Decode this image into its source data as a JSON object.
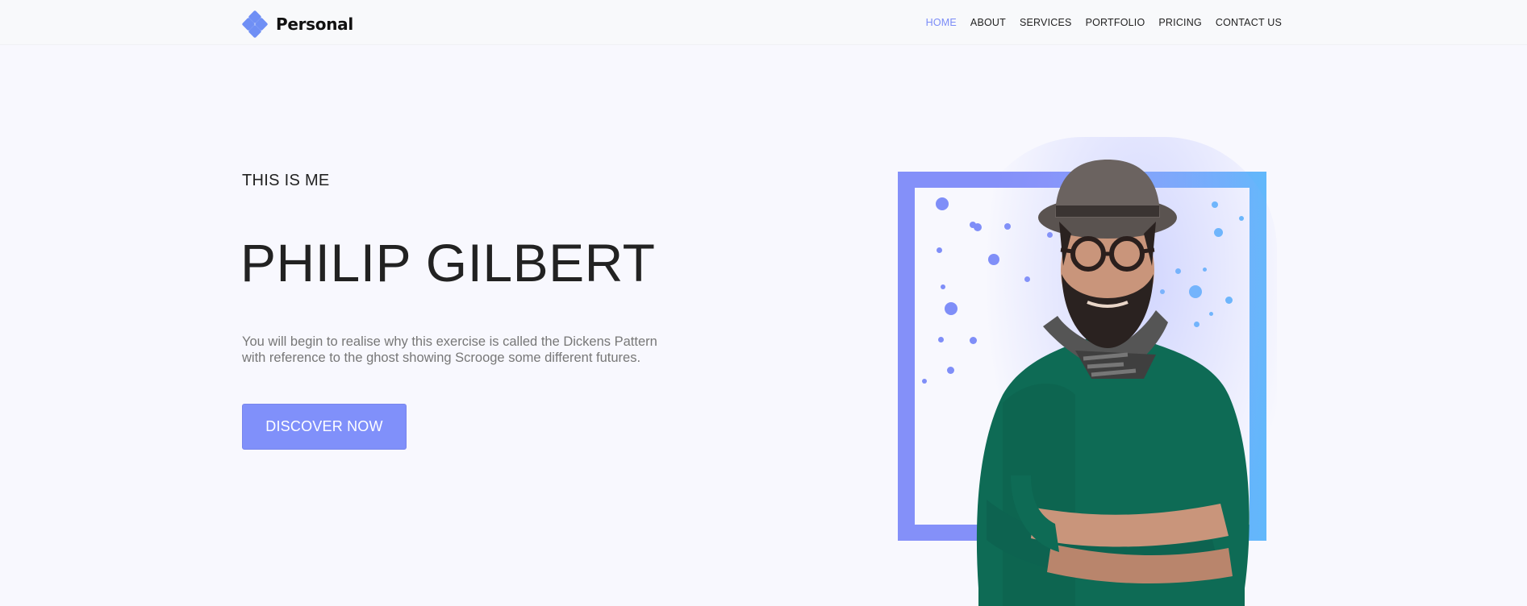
{
  "brand": {
    "name": "Personal",
    "icon": "diamond-cluster-icon",
    "color": "#6f8ff5"
  },
  "nav": {
    "items": [
      {
        "label": "HOME",
        "active": true
      },
      {
        "label": "ABOUT",
        "active": false
      },
      {
        "label": "SERVICES",
        "active": false
      },
      {
        "label": "PORTFOLIO",
        "active": false
      },
      {
        "label": "PRICING",
        "active": false
      },
      {
        "label": "CONTACT US",
        "active": false
      }
    ],
    "active_color": "#7b8cf7"
  },
  "hero": {
    "eyebrow": "THIS IS ME",
    "name": "PHILIP GILBERT",
    "description": "You will begin to realise why this exercise is called the Dickens Pattern with reference to the ghost showing Scrooge some different futures.",
    "cta_label": "DISCOVER NOW",
    "accent_color": "#8090fa",
    "frame_colors": [
      "#8490f9",
      "#62b8fb"
    ],
    "sweater_color": "#0e6b55"
  }
}
